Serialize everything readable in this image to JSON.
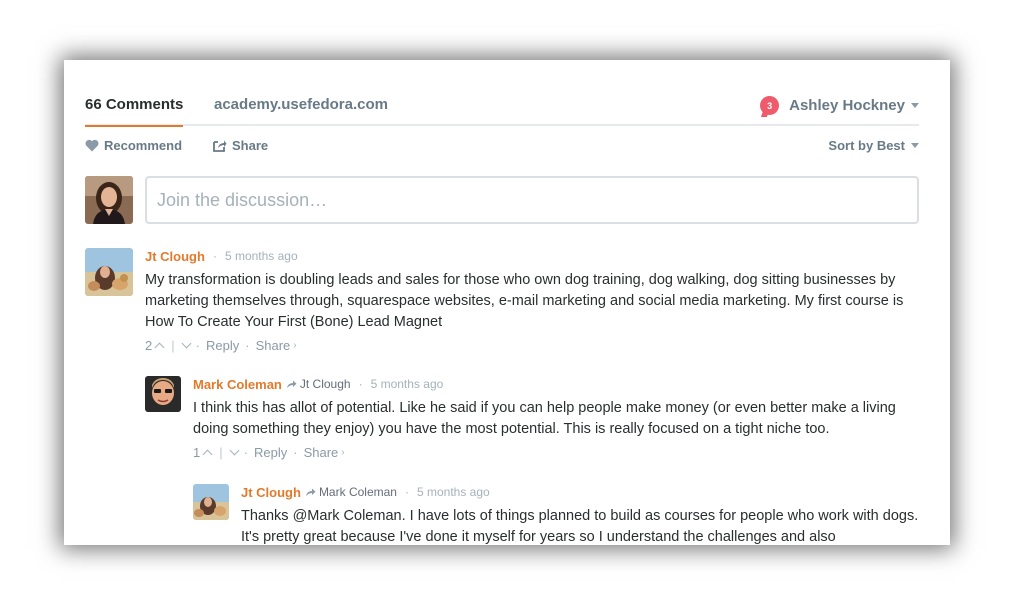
{
  "nav": {
    "comments_tab": "66 Comments",
    "site_tab": "academy.usefedora.com",
    "notification_count": "3",
    "user_name": "Ashley Hockney",
    "accent_color": "#e27a2c"
  },
  "actions": {
    "recommend_label": "Recommend",
    "share_label": "Share",
    "sort_label": "Sort by Best"
  },
  "composer": {
    "placeholder": "Join the discussion…"
  },
  "comments": [
    {
      "author": "Jt Clough",
      "time": "5 months ago",
      "text": "My transformation is doubling leads and sales for those who own dog training, dog walking, dog sitting businesses by marketing themselves through, squarespace websites, e-mail marketing and social media marketing. My first course is How To Create Your First (Bone) Lead Magnet",
      "votes": "2",
      "reply_label": "Reply",
      "share_label": "Share"
    },
    {
      "author": "Mark Coleman",
      "reply_to": "Jt Clough",
      "time": "5 months ago",
      "text": "I think this has allot of potential. Like he said if you can help people make money (or even better make a living doing something they enjoy) you have the most potential. This is really focused on a tight niche too.",
      "votes": "1",
      "reply_label": "Reply",
      "share_label": "Share"
    },
    {
      "author": "Jt Clough",
      "reply_to": "Mark Coleman",
      "time": "5 months ago",
      "text": "Thanks @Mark Coleman. I have lots of things planned to build as courses for people who work with dogs. It's pretty great because I've done it myself for years so I understand the challenges and also"
    }
  ]
}
